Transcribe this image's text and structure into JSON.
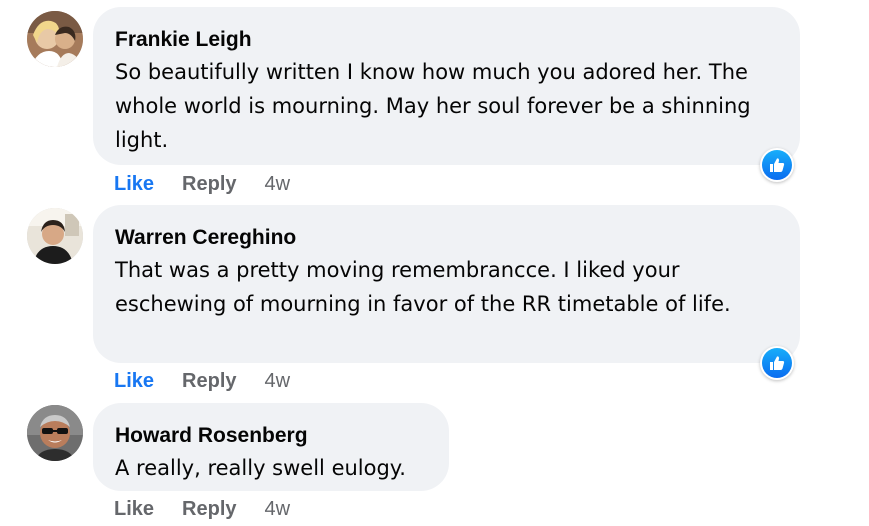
{
  "colors": {
    "bubble": "#f0f2f5",
    "link_blue": "#1877f2",
    "secondary_text": "#65676b",
    "reaction_blue": "#0a6cf0"
  },
  "comments": [
    {
      "author": "Frankie Leigh",
      "text": "So beautifully written I know how much you adored her. The whole world is mourning. May her soul forever be a shinning light.",
      "like_label": "Like",
      "reply_label": "Reply",
      "time": "4w",
      "liked": true,
      "reaction_icon": "thumbs-up-icon"
    },
    {
      "author": "Warren Cereghino",
      "text": "That was a pretty moving remembrancce. I liked your eschewing of mourning in favor of the RR timetable of life.",
      "like_label": "Like",
      "reply_label": "Reply",
      "time": "4w",
      "liked": true,
      "reaction_icon": "thumbs-up-icon"
    },
    {
      "author": "Howard Rosenberg",
      "text": "A really, really swell eulogy.",
      "like_label": "Like",
      "reply_label": "Reply",
      "time": "4w",
      "liked": false,
      "reaction_icon": ""
    }
  ]
}
